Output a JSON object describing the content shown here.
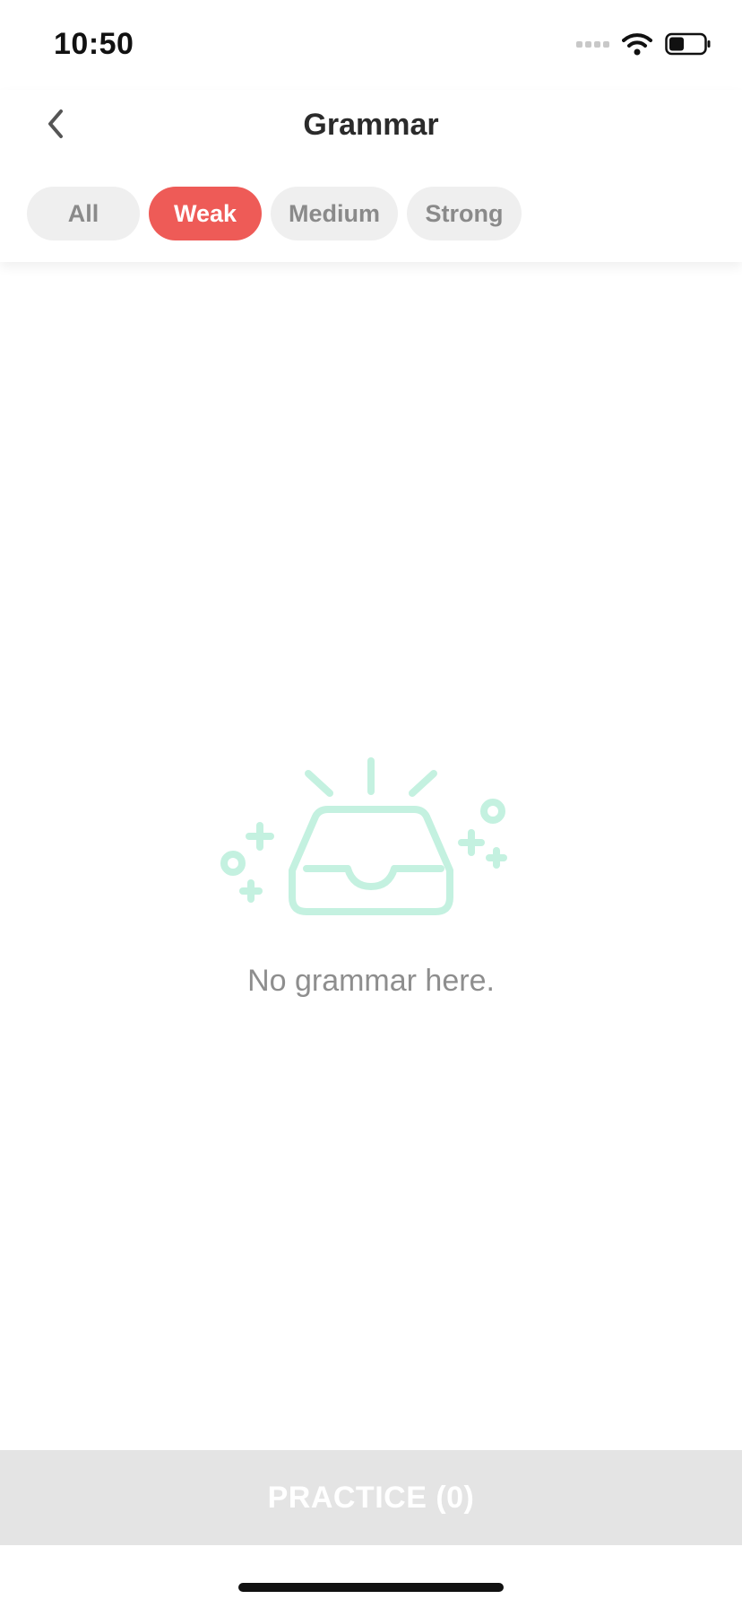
{
  "status_bar": {
    "time": "10:50",
    "icons": [
      "signal-icon",
      "wifi-icon",
      "battery-icon"
    ]
  },
  "header": {
    "back_icon": "chevron-left-icon",
    "title": "Grammar"
  },
  "filters": {
    "tabs": [
      {
        "label": "All",
        "active": false
      },
      {
        "label": "Weak",
        "active": true
      },
      {
        "label": "Medium",
        "active": false
      },
      {
        "label": "Strong",
        "active": false
      }
    ],
    "active_color": "#ee5b57",
    "inactive_color": "#efefef"
  },
  "empty_state": {
    "icon": "empty-inbox-icon",
    "icon_color": "#c4f1e0",
    "message": "No grammar here."
  },
  "footer": {
    "practice_label": "PRACTICE (0)"
  }
}
